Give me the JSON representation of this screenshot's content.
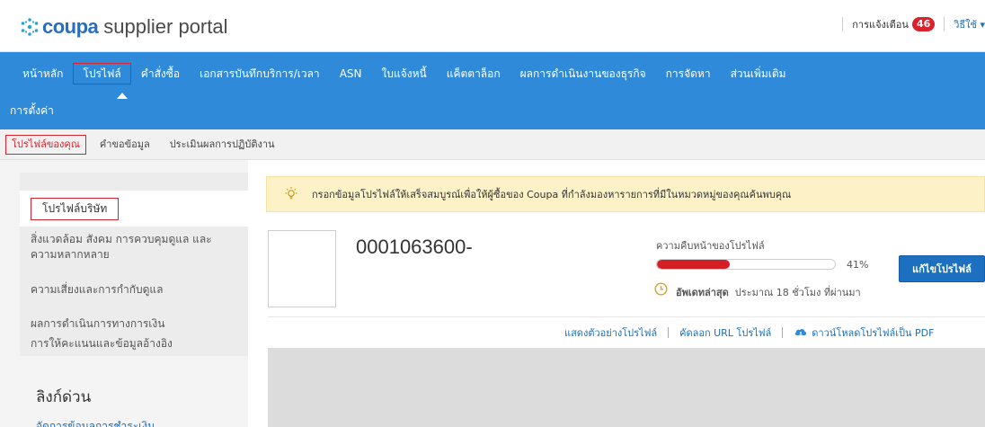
{
  "header": {
    "brand": "coupa",
    "portal": "supplier portal",
    "notifications_label": "การแจ้งเตือน",
    "notifications_count": "46",
    "help_label": "วิธีใช้ ▾"
  },
  "nav": {
    "items": [
      {
        "label": "หน้าหลัก"
      },
      {
        "label": "โปรไฟล์"
      },
      {
        "label": "คำสั่งซื้อ"
      },
      {
        "label": "เอกสารบันทึกบริการ/เวลา"
      },
      {
        "label": "ASN"
      },
      {
        "label": "ใบแจ้งหนี้"
      },
      {
        "label": "แค็ตตาล็อก"
      },
      {
        "label": "ผลการดำเนินงานของธุรกิจ"
      },
      {
        "label": "การจัดหา"
      },
      {
        "label": "ส่วนเพิ่มเติม"
      }
    ],
    "settings_label": "การตั้งค่า"
  },
  "subnav": {
    "items": [
      {
        "label": "โปรไฟล์ของคุณ"
      },
      {
        "label": "คำขอข้อมูล"
      },
      {
        "label": "ประเมินผลการปฏิบัติงาน"
      }
    ]
  },
  "sidebar": {
    "items": [
      {
        "label": "โปรไฟล์บริษัท"
      },
      {
        "label": "สิ่งแวดล้อม สังคม การควบคุมดูแล และความหลากหลาย"
      },
      {
        "label": "ความเสี่ยงและการกำกับดูแล"
      },
      {
        "label": "ผลการดำเนินการทางการเงิน"
      },
      {
        "label": "การให้คะแนนและข้อมูลอ้างอิง"
      }
    ],
    "quick_links_title": "ลิงก์ด่วน",
    "quick_link": "จัดการข้อมูลการชำระเงิน"
  },
  "main": {
    "banner_text": "กรอกข้อมูลโปรไฟล์ให้เสร็จสมบูรณ์เพื่อให้ผู้ซื้อของ Coupa ที่กำลังมองหารายการที่มีในหมวดหมู่ของคุณค้นพบคุณ",
    "company_id": "0001063600-",
    "progress_label": "ความคืบหน้าของโปรไฟล์",
    "progress_value": 0.41,
    "progress_text": "41%",
    "update_label": "อัพเดทล่าสุด",
    "update_time": "ประมาณ 18 ชั่วโมง ที่ผ่านมา",
    "edit_button": "แก้ไขโปรไฟล์",
    "actions": {
      "preview": "แสดงตัวอย่างโปรไฟล์",
      "copy_url": "คัดลอก URL โปรไฟล์",
      "download_pdf": "ดาวน์โหลดโปรไฟล์เป็น PDF"
    }
  },
  "colors": {
    "nav_bg": "#2f8ad9",
    "accent_red": "#d9232d",
    "link_blue": "#1f6fb3",
    "banner_bg": "#fdf1c7"
  }
}
